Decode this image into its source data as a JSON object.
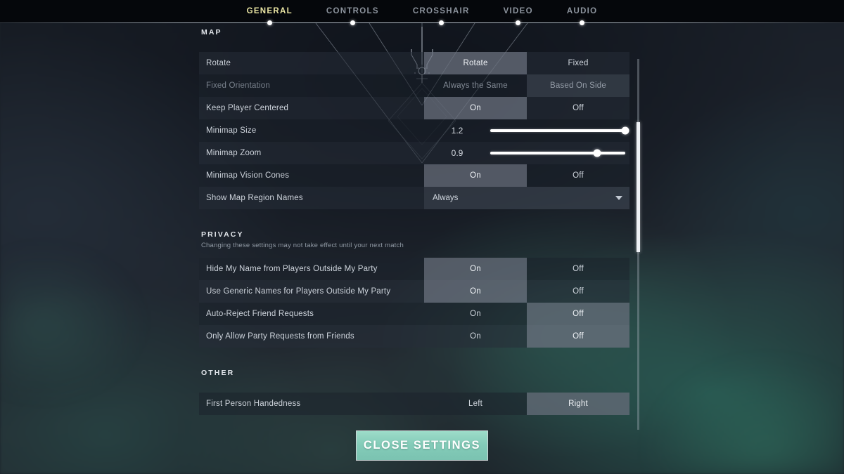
{
  "nav": {
    "tabs": [
      {
        "label": "GENERAL",
        "active": true
      },
      {
        "label": "CONTROLS",
        "active": false
      },
      {
        "label": "CROSSHAIR",
        "active": false
      },
      {
        "label": "VIDEO",
        "active": false
      },
      {
        "label": "AUDIO",
        "active": false
      }
    ]
  },
  "sections": [
    {
      "title": "MAP",
      "subtitle": "",
      "rows": [
        {
          "label": "Rotate",
          "type": "segmented",
          "options": [
            "Rotate",
            "Fixed"
          ],
          "selected": "Rotate",
          "disabled": false
        },
        {
          "label": "Fixed Orientation",
          "type": "segmented",
          "options": [
            "Always the Same",
            "Based On Side"
          ],
          "selected": "Based On Side",
          "disabled": true
        },
        {
          "label": "Keep Player Centered",
          "type": "segmented",
          "options": [
            "On",
            "Off"
          ],
          "selected": "On",
          "disabled": false
        },
        {
          "label": "Minimap Size",
          "type": "slider",
          "value": "1.2",
          "percent": 100
        },
        {
          "label": "Minimap Zoom",
          "type": "slider",
          "value": "0.9",
          "percent": 79
        },
        {
          "label": "Minimap Vision Cones",
          "type": "segmented",
          "options": [
            "On",
            "Off"
          ],
          "selected": "On",
          "disabled": false
        },
        {
          "label": "Show Map Region Names",
          "type": "dropdown",
          "value": "Always",
          "icon": "chevron-down-icon"
        }
      ]
    },
    {
      "title": "PRIVACY",
      "subtitle": "Changing these settings may not take effect until your next match",
      "rows": [
        {
          "label": "Hide My Name from Players Outside My Party",
          "type": "segmented",
          "options": [
            "On",
            "Off"
          ],
          "selected": "On",
          "disabled": false
        },
        {
          "label": "Use Generic Names for Players Outside My Party",
          "type": "segmented",
          "options": [
            "On",
            "Off"
          ],
          "selected": "On",
          "disabled": false
        },
        {
          "label": "Auto-Reject Friend Requests",
          "type": "segmented",
          "options": [
            "On",
            "Off"
          ],
          "selected": "Off",
          "disabled": false
        },
        {
          "label": "Only Allow Party Requests from Friends",
          "type": "segmented",
          "options": [
            "On",
            "Off"
          ],
          "selected": "Off",
          "disabled": false
        }
      ]
    },
    {
      "title": "OTHER",
      "subtitle": "",
      "rows": [
        {
          "label": "First Person Handedness",
          "type": "segmented",
          "options": [
            "Left",
            "Right"
          ],
          "selected": "Right",
          "disabled": false
        }
      ]
    }
  ],
  "footer": {
    "close_label": "CLOSE SETTINGS"
  },
  "scrollbar": {
    "thumb_position_percent": 17,
    "thumb_size_percent": 35
  },
  "colors": {
    "accent_tab": "#ebe6a4",
    "close_button": "#83cbb8",
    "selected_segment": "#969eac",
    "panel_row_odd": "#262d38",
    "panel_row_even": "#1c222b"
  }
}
